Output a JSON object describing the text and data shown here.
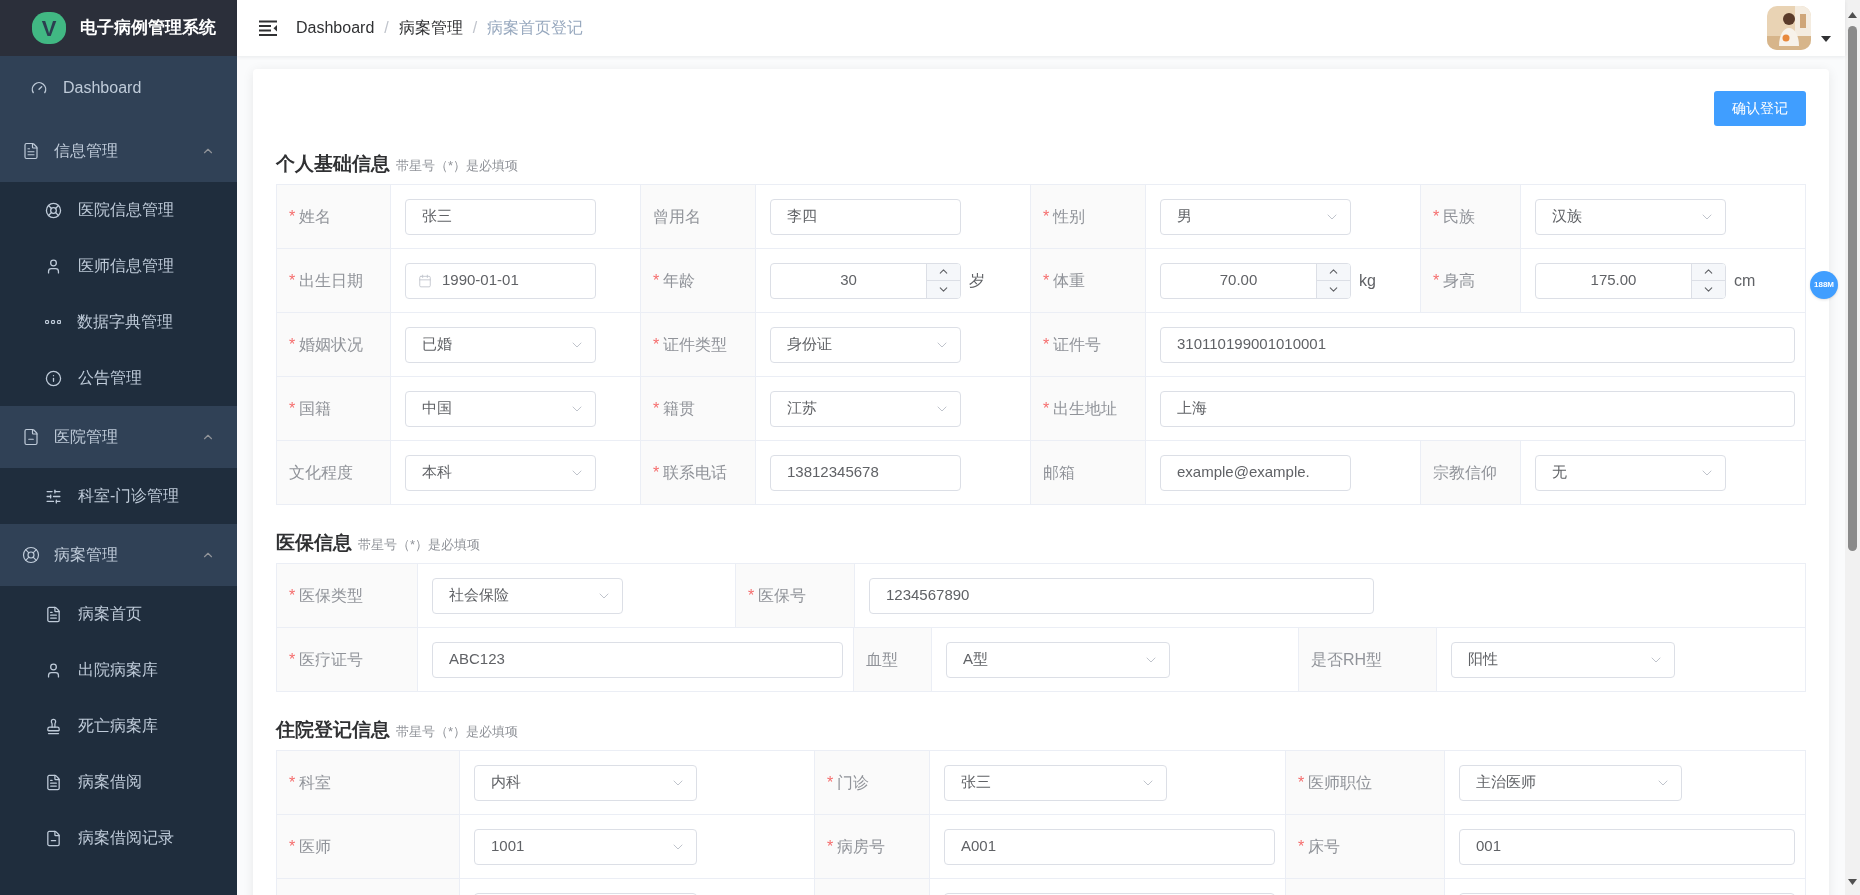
{
  "sidebar": {
    "logo_letter": "V",
    "app_title": "电子病例管理系统",
    "menu": [
      {
        "kind": "item",
        "label": "Dashboard"
      },
      {
        "kind": "group",
        "label": "信息管理",
        "expanded": true,
        "children": [
          {
            "label": "医院信息管理"
          },
          {
            "label": "医师信息管理"
          },
          {
            "label": "数据字典管理"
          },
          {
            "label": "公告管理"
          }
        ]
      },
      {
        "kind": "group",
        "label": "医院管理",
        "expanded": true,
        "children": [
          {
            "label": "科室-门诊管理"
          }
        ]
      },
      {
        "kind": "group",
        "label": "病案管理",
        "expanded": true,
        "children": [
          {
            "label": "病案首页"
          },
          {
            "label": "出院病案库"
          },
          {
            "label": "死亡病案库"
          },
          {
            "label": "病案借阅"
          },
          {
            "label": "病案借阅记录"
          }
        ]
      }
    ]
  },
  "breadcrumb": {
    "items": [
      {
        "label": "Dashboard",
        "current": false
      },
      {
        "label": "病案管理",
        "current": false
      },
      {
        "label": "病案首页登记",
        "current": true
      }
    ],
    "separators": [
      "/",
      "/"
    ]
  },
  "memory_badge": "188M",
  "confirm_button": "确认登记",
  "sections": [
    {
      "title": "个人基础信息",
      "hint": "带星号（*）是必填项",
      "rows": [
        [
          {
            "required_mark": "*",
            "label": "姓名",
            "field": {
              "kind": "text",
              "value": "张三"
            }
          },
          {
            "label": "曾用名",
            "field": {
              "kind": "text",
              "value": "李四"
            }
          },
          {
            "required_mark": "*",
            "label": "性别",
            "field": {
              "kind": "select",
              "value": "男"
            }
          },
          {
            "required_mark": "*",
            "label": "民族",
            "field": {
              "kind": "select",
              "value": "汉族"
            }
          }
        ],
        [
          {
            "required_mark": "*",
            "label": "出生日期",
            "field": {
              "kind": "date",
              "value": "1990-01-01"
            }
          },
          {
            "required_mark": "*",
            "label": "年龄",
            "field": {
              "kind": "number",
              "value": "30",
              "unit": "岁"
            }
          },
          {
            "required_mark": "*",
            "label": "体重",
            "field": {
              "kind": "number",
              "value": "70.00",
              "unit": "kg"
            }
          },
          {
            "required_mark": "*",
            "label": "身高",
            "field": {
              "kind": "number",
              "value": "175.00",
              "unit": "cm"
            }
          }
        ],
        [
          {
            "required_mark": "*",
            "label": "婚姻状况",
            "field": {
              "kind": "select",
              "value": "已婚"
            }
          },
          {
            "required_mark": "*",
            "label": "证件类型",
            "field": {
              "kind": "select",
              "value": "身份证"
            }
          },
          {
            "required_mark": "*",
            "label": "证件号",
            "field": {
              "kind": "text",
              "value": "310110199001010001"
            }
          }
        ],
        [
          {
            "required_mark": "*",
            "label": "国籍",
            "field": {
              "kind": "select",
              "value": "中国"
            }
          },
          {
            "required_mark": "*",
            "label": "籍贯",
            "field": {
              "kind": "select",
              "value": "江苏"
            }
          },
          {
            "required_mark": "*",
            "label": "出生地址",
            "field": {
              "kind": "text",
              "value": "上海"
            }
          }
        ],
        [
          {
            "label": "文化程度",
            "field": {
              "kind": "select",
              "value": "本科"
            }
          },
          {
            "required_mark": "*",
            "label": "联系电话",
            "field": {
              "kind": "text",
              "value": "13812345678"
            }
          },
          {
            "label": "邮箱",
            "field": {
              "kind": "text",
              "value": "example@example."
            }
          },
          {
            "label": "宗教信仰",
            "field": {
              "kind": "select",
              "value": "无"
            }
          }
        ]
      ]
    },
    {
      "title": "医保信息",
      "hint": "带星号（*）是必填项",
      "rows": [
        [
          {
            "required_mark": "*",
            "label": "医保类型",
            "field": {
              "kind": "select",
              "value": "社会保险"
            }
          },
          {
            "required_mark": "*",
            "label": "医保号",
            "field": {
              "kind": "text",
              "value": "1234567890"
            }
          }
        ],
        [
          {
            "required_mark": "*",
            "label": "医疗证号",
            "field": {
              "kind": "text",
              "value": "ABC123"
            }
          },
          {
            "label": "血型",
            "field": {
              "kind": "select",
              "value": "A型"
            }
          },
          {
            "label": "是否RH型",
            "field": {
              "kind": "select",
              "value": "阳性"
            }
          }
        ]
      ]
    },
    {
      "title": "住院登记信息",
      "hint": "带星号（*）是必填项",
      "rows": [
        [
          {
            "required_mark": "*",
            "label": "科室",
            "field": {
              "kind": "select",
              "value": "内科"
            }
          },
          {
            "required_mark": "*",
            "label": "门诊",
            "field": {
              "kind": "select",
              "value": "张三"
            }
          },
          {
            "required_mark": "*",
            "label": "医师职位",
            "field": {
              "kind": "select",
              "value": "主治医师"
            }
          }
        ],
        [
          {
            "required_mark": "*",
            "label": "医师",
            "field": {
              "kind": "select",
              "value": "1001"
            }
          },
          {
            "required_mark": "*",
            "label": "病房号",
            "field": {
              "kind": "text",
              "value": "A001"
            }
          },
          {
            "required_mark": "*",
            "label": "床号",
            "field": {
              "kind": "text",
              "value": "001"
            }
          }
        ]
      ]
    }
  ]
}
